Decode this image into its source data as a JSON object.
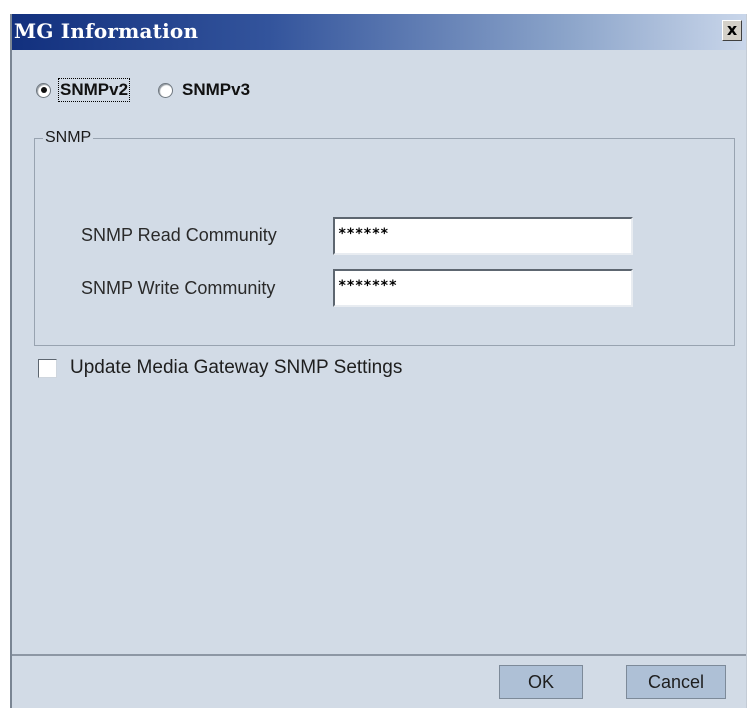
{
  "window": {
    "title": "MG Information",
    "close_label": "x"
  },
  "version": {
    "options": [
      {
        "label": "SNMPv2",
        "selected": true
      },
      {
        "label": "SNMPv3",
        "selected": false
      }
    ]
  },
  "snmp_group": {
    "legend": "SNMP",
    "read_label": "SNMP Read Community",
    "read_value": "******",
    "write_label": "SNMP Write Community",
    "write_value": "*******"
  },
  "update": {
    "label": "Update Media Gateway SNMP Settings",
    "checked": false
  },
  "buttons": {
    "ok": "OK",
    "cancel": "Cancel"
  },
  "colors": {
    "dialog_bg": "#d2dbe6",
    "title_start": "#12307e",
    "button_bg": "#aec0d6"
  }
}
